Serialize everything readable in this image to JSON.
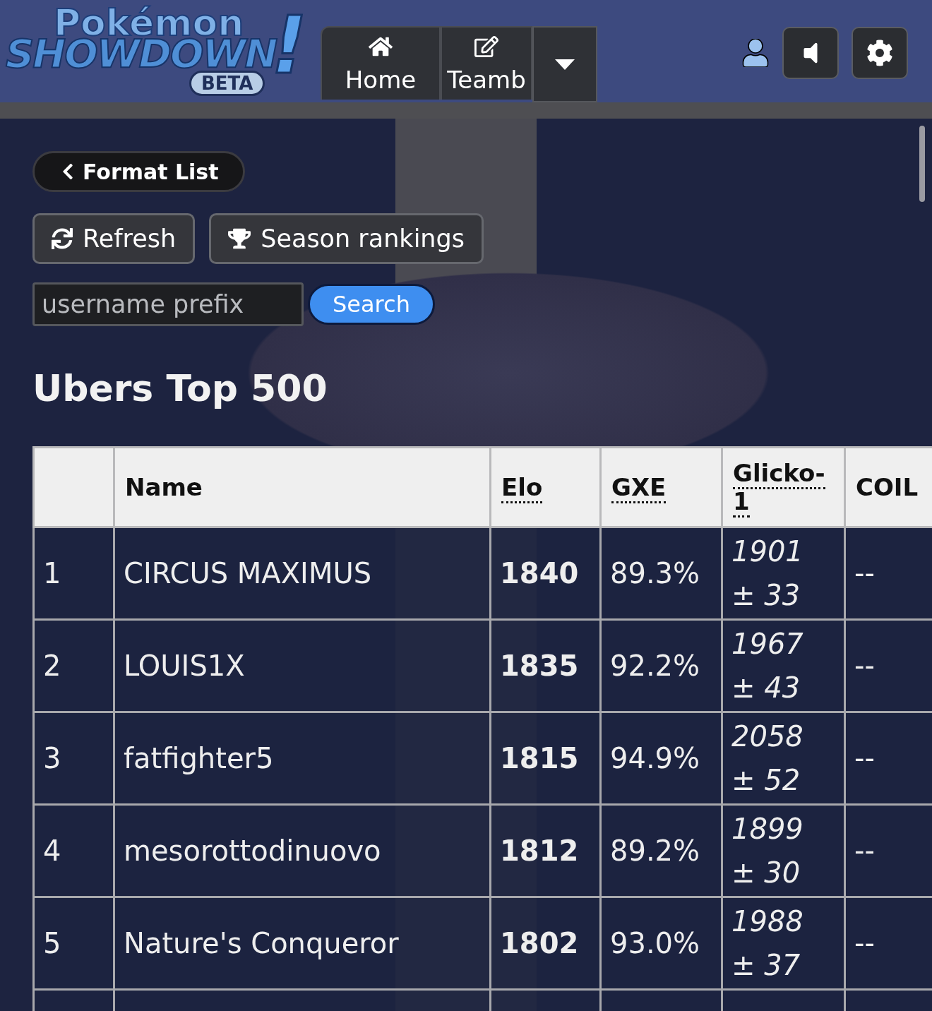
{
  "header": {
    "logo": {
      "word_1": "Pokémon",
      "word_2": "SHOWDOWN",
      "mark": "!",
      "badge": "BETA"
    },
    "tabs": [
      {
        "label": "Home",
        "selected": false
      },
      {
        "label": "Teamb",
        "selected": false
      }
    ]
  },
  "back_button": "Format List",
  "actions": [
    {
      "label": "Refresh"
    },
    {
      "label": "Season rankings"
    }
  ],
  "search": {
    "placeholder": "username prefix",
    "button": "Search"
  },
  "title": "Ubers Top 500",
  "table": {
    "columns": [
      {
        "label": "Name",
        "dotted": false
      },
      {
        "label": "Elo",
        "dotted": true
      },
      {
        "label": "GXE",
        "dotted": true
      },
      {
        "label": "Glicko-1",
        "dotted": true
      },
      {
        "label": "COIL",
        "dotted": false
      }
    ],
    "rows": [
      {
        "rank": "1",
        "name": "CIRCUS MAXIMUS",
        "elo": "1840",
        "gxe": "89.3%",
        "glicko": "1901",
        "deviation": "± 33",
        "coil": "--"
      },
      {
        "rank": "2",
        "name": "LOUIS1X",
        "elo": "1835",
        "gxe": "92.2%",
        "glicko": "1967",
        "deviation": "± 43",
        "coil": "--"
      },
      {
        "rank": "3",
        "name": "fatfighter5",
        "elo": "1815",
        "gxe": "94.9%",
        "glicko": "2058",
        "deviation": "± 52",
        "coil": "--"
      },
      {
        "rank": "4",
        "name": "mesorottodinuovo",
        "elo": "1812",
        "gxe": "89.2%",
        "glicko": "1899",
        "deviation": "± 30",
        "coil": "--"
      },
      {
        "rank": "5",
        "name": "Nature's Conqueror",
        "elo": "1802",
        "gxe": "93.0%",
        "glicko": "1988",
        "deviation": "± 37",
        "coil": "--"
      }
    ]
  }
}
